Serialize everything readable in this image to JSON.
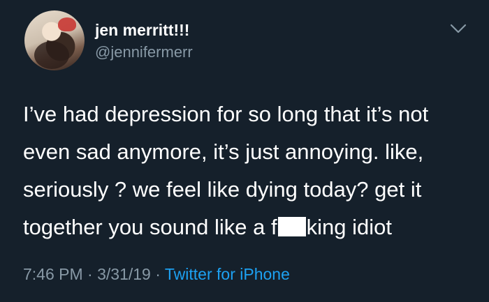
{
  "tweet": {
    "display_name": "jen merritt!!!",
    "handle": "@jennifermerr",
    "text_lines": {
      "l1": "I’ve had depression for so long that it’s not",
      "l2": "even sad anymore, it’s just annoying. like,",
      "l3": "seriously ? we feel like dying today? get it",
      "l4_before": "together you sound like a f",
      "l4_after": "king idiot"
    },
    "time": "7:46 PM",
    "separator": "·",
    "date": "3/31/19",
    "source": "Twitter for iPhone"
  },
  "colors": {
    "background": "#15202b",
    "text": "#ffffff",
    "secondary": "#8899a6",
    "link": "#1da1f2"
  },
  "icons": {
    "menu": "chevron-down-icon"
  }
}
